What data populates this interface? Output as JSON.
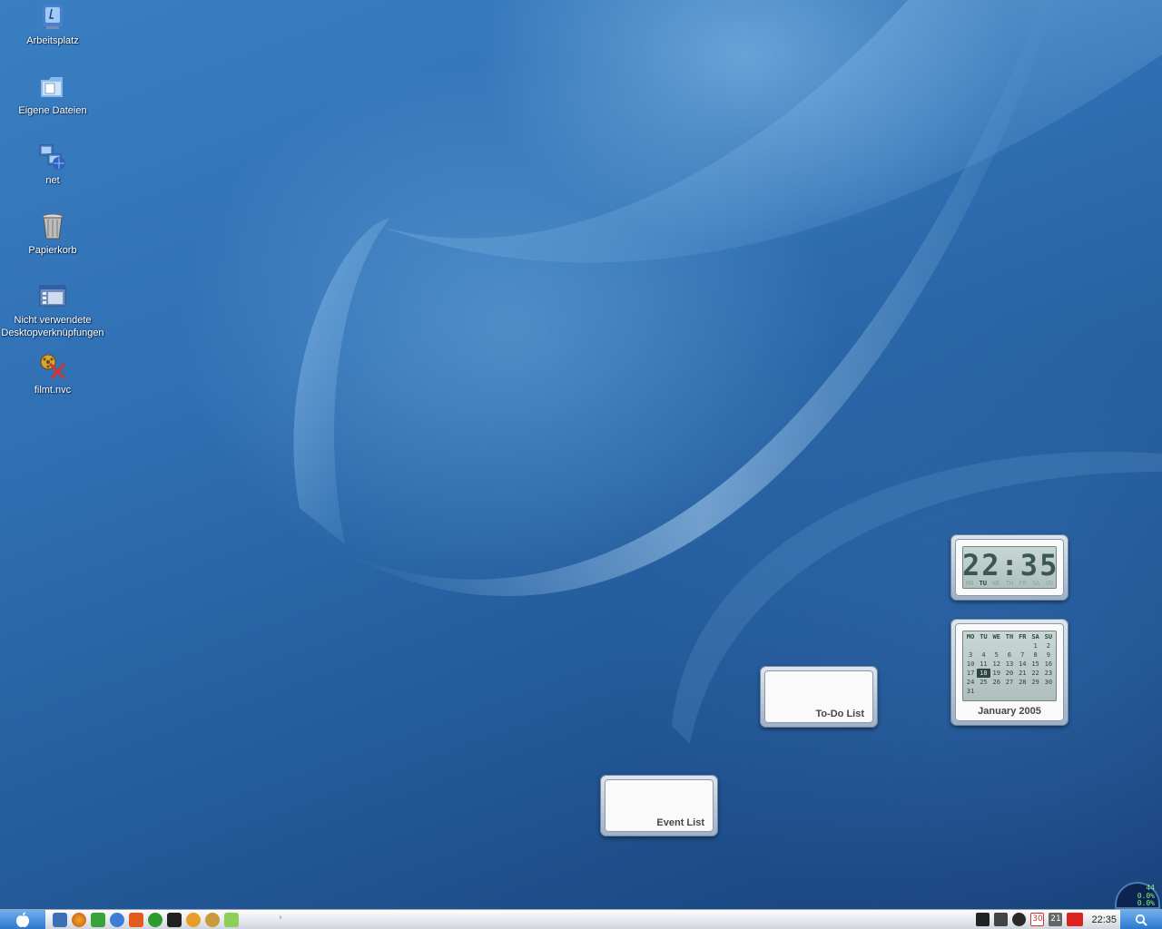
{
  "desktop_icons": [
    {
      "label": "Arbeitsplatz",
      "icon": "computer-icon"
    },
    {
      "label": "Eigene Dateien",
      "icon": "documents-folder-icon"
    },
    {
      "label": "net",
      "icon": "network-icon"
    },
    {
      "label": "Papierkorb",
      "icon": "recycle-bin-icon"
    },
    {
      "label": "Nicht verwendete Desktopverknüpfungen",
      "icon": "unused-shortcuts-icon"
    },
    {
      "label": "filmt.nvc",
      "icon": "media-file-icon"
    }
  ],
  "clock": {
    "time": "22:35",
    "days": [
      "MO",
      "TU",
      "WE",
      "TH",
      "FR",
      "SA",
      "SU"
    ],
    "active_day": "TU"
  },
  "calendar": {
    "title": "January 2005",
    "headers": [
      "MO",
      "TU",
      "WE",
      "TH",
      "FR",
      "SA",
      "SU"
    ],
    "today": "18",
    "rows": [
      [
        "",
        "",
        "",
        "",
        "",
        "1",
        "2"
      ],
      [
        "3",
        "4",
        "5",
        "6",
        "7",
        "8",
        "9"
      ],
      [
        "10",
        "11",
        "12",
        "13",
        "14",
        "15",
        "16"
      ],
      [
        "17",
        "18",
        "19",
        "20",
        "21",
        "22",
        "23"
      ],
      [
        "24",
        "25",
        "26",
        "27",
        "28",
        "29",
        "30"
      ],
      [
        "31",
        "",
        "",
        "",
        "",
        "",
        ""
      ]
    ]
  },
  "widgets": {
    "todo_title": "To-Do List",
    "event_title": "Event List"
  },
  "taskbar": {
    "clock": "22:35",
    "quicklaunch": [
      "show-desktop-icon",
      "firefox-icon",
      "download-icon",
      "ie-icon",
      "mail-icon",
      "icq-icon",
      "steam-icon",
      "app-icon",
      "app2-icon",
      "music-icon"
    ],
    "tray": [
      "steam-tray-icon",
      "media-tray-icon",
      "phone-tray-icon",
      "day-30-icon",
      "day-21-icon",
      "ati-tray-icon"
    ],
    "tray_day_a": "30",
    "tray_day_b": "21"
  },
  "meter": {
    "line1": "0.0%",
    "line2": "0.0%",
    "top": "44"
  },
  "colors": {
    "desktop_blue": "#2f6fb3",
    "lcd": "#c9d8d6",
    "start_blue": "#2d78cd"
  }
}
